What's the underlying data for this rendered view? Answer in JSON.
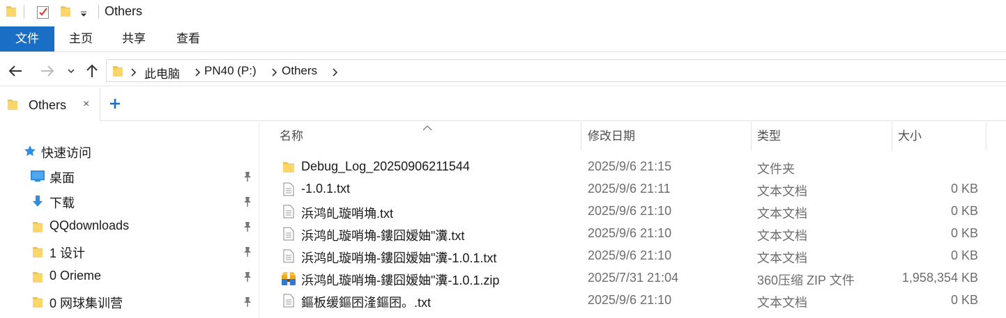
{
  "window": {
    "title": "Others"
  },
  "ribbon": {
    "tabs": [
      "文件",
      "主页",
      "共享",
      "查看"
    ]
  },
  "address": {
    "crumbs": [
      "此电脑",
      "PN40 (P:)",
      "Others"
    ]
  },
  "tabs": {
    "active_label": "Others",
    "close_glyph": "×"
  },
  "nav": {
    "items": [
      {
        "label": "快速访问",
        "icon": "star-icon",
        "pinned": false
      },
      {
        "label": "桌面",
        "icon": "desktop-icon",
        "pinned": true
      },
      {
        "label": "下载",
        "icon": "download-arrow-icon",
        "pinned": true
      },
      {
        "label": "QQdownloads",
        "icon": "folder-icon",
        "pinned": true
      },
      {
        "label": "1 设计",
        "icon": "folder-icon",
        "pinned": true
      },
      {
        "label": "0 Orieme",
        "icon": "folder-icon",
        "pinned": true
      },
      {
        "label": "0 网球集训营",
        "icon": "folder-icon",
        "pinned": true
      }
    ]
  },
  "columns": {
    "name": "名称",
    "date": "修改日期",
    "type": "类型",
    "size": "大小"
  },
  "files": [
    {
      "name": "Debug_Log_20250906211544",
      "date": "2025/9/6 21:15",
      "type": "文件夹",
      "size": "",
      "icon": "folder-icon"
    },
    {
      "name": "-1.0.1.txt",
      "date": "2025/9/6 21:11",
      "type": "文本文档",
      "size": "0 KB",
      "icon": "text-file-icon"
    },
    {
      "name": "浜鸿癿璇哨埆.txt",
      "date": "2025/9/6 21:10",
      "type": "文本文档",
      "size": "0 KB",
      "icon": "text-file-icon"
    },
    {
      "name": "浜鸿癿璇哨埆-鏤囧嫒妯\"瀵.txt",
      "date": "2025/9/6 21:10",
      "type": "文本文档",
      "size": "0 KB",
      "icon": "text-file-icon"
    },
    {
      "name": "浜鸿癿璇哨埆-鏤囧嫒妯\"瀵-1.0.1.txt",
      "date": "2025/9/6 21:10",
      "type": "文本文档",
      "size": "0 KB",
      "icon": "text-file-icon"
    },
    {
      "name": "浜鸿癿璇哨埆-鏤囧嫒妯\"瀵-1.0.1.zip",
      "date": "2025/7/31 21:04",
      "type": "360压缩 ZIP 文件",
      "size": "1,958,354 KB",
      "icon": "zip-archive-icon"
    },
    {
      "name": "鏂板缓鏂囨湰鏂囨。.txt",
      "date": "2025/9/6 21:10",
      "type": "文本文档",
      "size": "0 KB",
      "icon": "text-file-icon"
    }
  ],
  "colors": {
    "accent": "#1a6fc4",
    "folder": "#f4c542",
    "plus": "#1a6fc4"
  }
}
